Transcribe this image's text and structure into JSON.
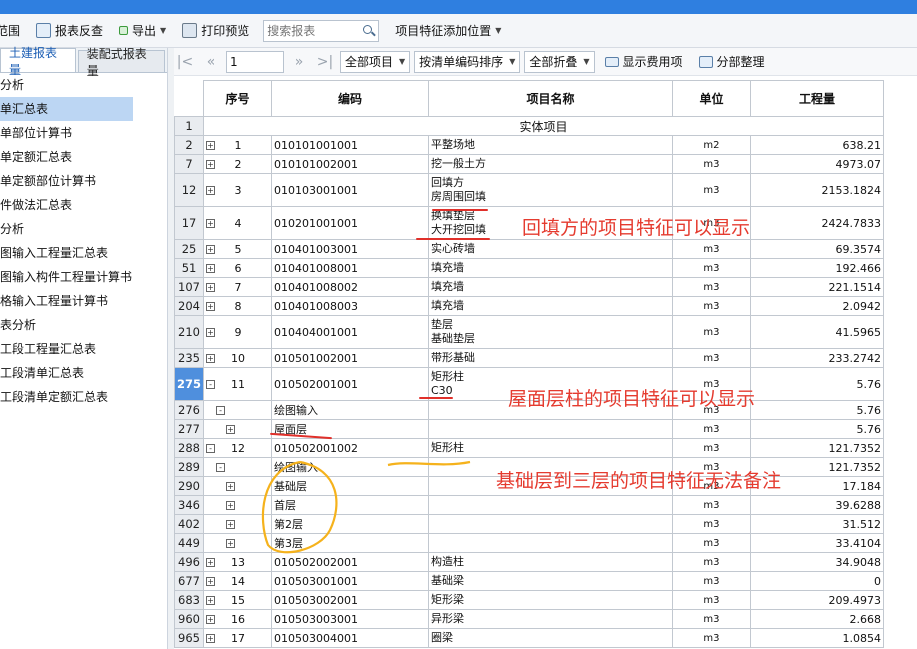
{
  "toolbar": {
    "partial": "范围",
    "check": "报表反查",
    "export": "导出",
    "print": "打印预览",
    "search_placeholder": "搜索报表",
    "feature_position": "项目特征添加位置"
  },
  "sidebar": {
    "tabs": [
      "土建报表量",
      "装配式报表量"
    ],
    "items": [
      "分析",
      "单汇总表",
      "单部位计算书",
      "单定额汇总表",
      "单定额部位计算书",
      "件做法汇总表",
      "分析",
      "图输入工程量汇总表",
      "图输入构件工程量计算书",
      "格输入工程量计算书",
      "表分析",
      "工段工程量汇总表",
      "工段清单汇总表",
      "工段清单定额汇总表"
    ],
    "selected_index": 1
  },
  "nav": {
    "page": "1",
    "filter": "全部项目",
    "sort": "按清单编码排序",
    "fold": "全部折叠",
    "show_cost": "显示费用项",
    "organize": "分部整理"
  },
  "table": {
    "headers": [
      "序号",
      "编码",
      "项目名称",
      "单位",
      "工程量"
    ],
    "section": "实体项目",
    "rows": [
      {
        "rn": "2",
        "tog": "+",
        "seq": "1",
        "code": "010101001001",
        "name": [
          "平整场地"
        ],
        "unit": "m2",
        "qty": "638.21"
      },
      {
        "rn": "7",
        "tog": "+",
        "seq": "2",
        "code": "010101002001",
        "name": [
          "挖一般土方"
        ],
        "unit": "m3",
        "qty": "4973.07"
      },
      {
        "rn": "12",
        "tog": "+",
        "seq": "3",
        "code": "010103001001",
        "name": [
          "回填方",
          "房周围回填"
        ],
        "unit": "m3",
        "qty": "2153.1824"
      },
      {
        "rn": "17",
        "tog": "+",
        "seq": "4",
        "code": "010201001001",
        "name": [
          "换填垫层",
          "大开挖回填"
        ],
        "unit": "m3",
        "qty": "2424.7833"
      },
      {
        "rn": "25",
        "tog": "+",
        "seq": "5",
        "code": "010401003001",
        "name": [
          "实心砖墙"
        ],
        "unit": "m3",
        "qty": "69.3574"
      },
      {
        "rn": "51",
        "tog": "+",
        "seq": "6",
        "code": "010401008001",
        "name": [
          "填充墙"
        ],
        "unit": "m3",
        "qty": "192.466"
      },
      {
        "rn": "107",
        "tog": "+",
        "seq": "7",
        "code": "010401008002",
        "name": [
          "填充墙"
        ],
        "unit": "m3",
        "qty": "221.1514"
      },
      {
        "rn": "204",
        "tog": "+",
        "seq": "8",
        "code": "010401008003",
        "name": [
          "填充墙"
        ],
        "unit": "m3",
        "qty": "2.0942"
      },
      {
        "rn": "210",
        "tog": "+",
        "seq": "9",
        "code": "010404001001",
        "name": [
          "垫层",
          "基础垫层"
        ],
        "unit": "m3",
        "qty": "41.5965"
      },
      {
        "rn": "235",
        "tog": "+",
        "seq": "10",
        "code": "010501002001",
        "name": [
          "带形基础"
        ],
        "unit": "m3",
        "qty": "233.2742"
      },
      {
        "rn": "275",
        "tog": "-",
        "seq": "11",
        "code": "010502001001",
        "name": [
          "矩形柱",
          "C30"
        ],
        "unit": "m3",
        "qty": "5.76"
      },
      {
        "rn": "276",
        "tog": "-",
        "seq": "",
        "code": "绘图输入",
        "name": [
          ""
        ],
        "unit": "m3",
        "qty": "5.76",
        "level": 1
      },
      {
        "rn": "277",
        "tog": "+",
        "seq": "",
        "code": "屋面层",
        "name": [
          ""
        ],
        "unit": "m3",
        "qty": "5.76",
        "level": 2
      },
      {
        "rn": "288",
        "tog": "-",
        "seq": "12",
        "code": "010502001002",
        "name": [
          "矩形柱"
        ],
        "unit": "m3",
        "qty": "121.7352"
      },
      {
        "rn": "289",
        "tog": "-",
        "seq": "",
        "code": "绘图输入",
        "name": [
          ""
        ],
        "unit": "m3",
        "qty": "121.7352",
        "level": 1
      },
      {
        "rn": "290",
        "tog": "+",
        "seq": "",
        "code": "基础层",
        "name": [
          ""
        ],
        "unit": "m3",
        "qty": "17.184",
        "level": 2
      },
      {
        "rn": "346",
        "tog": "+",
        "seq": "",
        "code": "首层",
        "name": [
          ""
        ],
        "unit": "m3",
        "qty": "39.6288",
        "level": 2
      },
      {
        "rn": "402",
        "tog": "+",
        "seq": "",
        "code": "第2层",
        "name": [
          ""
        ],
        "unit": "m3",
        "qty": "31.512",
        "level": 2
      },
      {
        "rn": "449",
        "tog": "+",
        "seq": "",
        "code": "第3层",
        "name": [
          ""
        ],
        "unit": "m3",
        "qty": "33.4104",
        "level": 2
      },
      {
        "rn": "496",
        "tog": "+",
        "seq": "13",
        "code": "010502002001",
        "name": [
          "构造柱"
        ],
        "unit": "m3",
        "qty": "34.9048"
      },
      {
        "rn": "677",
        "tog": "+",
        "seq": "14",
        "code": "010503001001",
        "name": [
          "基础梁"
        ],
        "unit": "m3",
        "qty": "0"
      },
      {
        "rn": "683",
        "tog": "+",
        "seq": "15",
        "code": "010503002001",
        "name": [
          "矩形梁"
        ],
        "unit": "m3",
        "qty": "209.4973"
      },
      {
        "rn": "960",
        "tog": "+",
        "seq": "16",
        "code": "010503003001",
        "name": [
          "异形梁"
        ],
        "unit": "m3",
        "qty": "2.668"
      },
      {
        "rn": "965",
        "tog": "+",
        "seq": "17",
        "code": "010503004001",
        "name": [
          "圈梁"
        ],
        "unit": "m3",
        "qty": "1.0854"
      }
    ]
  },
  "annotations": [
    "回填方的项目特征可以显示",
    "屋面层柱的项目特征可以显示",
    "基础层到三层的项目特征无法备注"
  ],
  "colors": {
    "annotation_red": "#e53b2f",
    "circle_yellow": "#f5b21c",
    "selected_row": "#4f8fdd",
    "title_bar": "#2f7fe0"
  }
}
